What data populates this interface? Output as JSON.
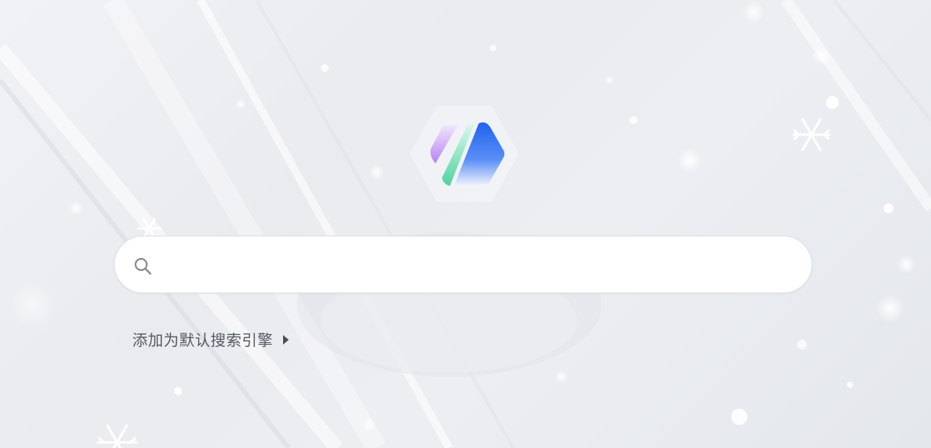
{
  "logo": {
    "icon": "app-logo-icon"
  },
  "search": {
    "icon": "search-icon",
    "placeholder": "",
    "value": ""
  },
  "default_engine_link": {
    "label": "添加为默认搜索引擎",
    "icon": "caret-right-icon"
  },
  "colors": {
    "background": "#eceef2",
    "search_bg": "#ffffff",
    "link_text": "#555a61",
    "logo_blue": "#2f6bf2",
    "logo_purple": "#b98cf5",
    "logo_green": "#5fd6a8"
  }
}
